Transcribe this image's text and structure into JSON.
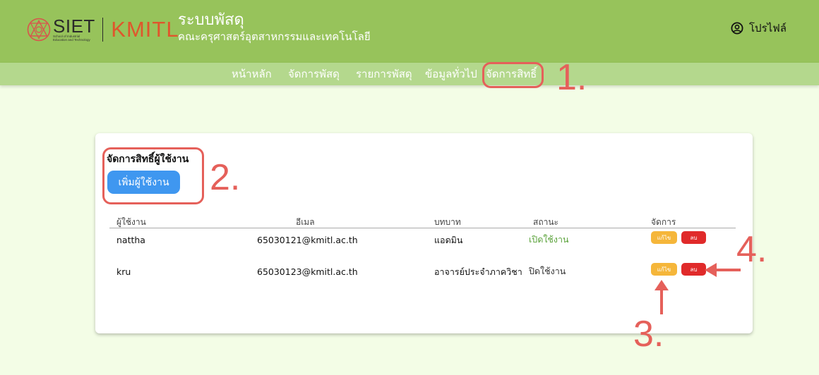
{
  "header": {
    "logo_siet": "SIET",
    "logo_siet_subtitle": [
      "School of Industrial",
      "Education and Technology"
    ],
    "logo_kmitl": "KMITL",
    "title": "ระบบพัสดุ",
    "subtitle": "คณะครุศาสตร์อุตสาหกรรมและเทคโนโลยี",
    "profile_label": "โปรไฟล์",
    "profile_icon": "user-circle-icon"
  },
  "nav": {
    "items": [
      {
        "label": "หน้าหลัก"
      },
      {
        "label": "จัดการพัสดุ"
      },
      {
        "label": "รายการพัสดุ"
      },
      {
        "label": "ข้อมูลทั่วไป"
      },
      {
        "label": "จัดการสิทธิ์",
        "active": true
      }
    ]
  },
  "card": {
    "title": "จัดการสิทธิ์ผู้ใช้งาน",
    "add_button_label": "เพิ่มผู้ใช้งาน"
  },
  "table": {
    "headers": [
      "ผู้ใช้งาน",
      "อีเมล",
      "บทบาท",
      "สถานะ",
      "จัดการ"
    ],
    "rows": [
      {
        "username": "nattha",
        "email": "65030121@kmitl.ac.th",
        "role": "แอดมิน",
        "status": "เปิดใช้งาน",
        "status_type": "active",
        "edit_label": "แก้ไข",
        "delete_label": "ลบ"
      },
      {
        "username": "kru",
        "email": "65030123@kmitl.ac.th",
        "role": "อาจารย์ประจำภาควิชา",
        "status": "ปิดใช้งาน",
        "status_type": "inactive",
        "edit_label": "แก้ไข",
        "delete_label": "ลบ"
      }
    ]
  },
  "annotations": {
    "markers": [
      "1.",
      "2.",
      "3.",
      "4."
    ],
    "color": "#e5605a"
  },
  "colors": {
    "header_bg": "#97c35b",
    "nav_bg": "#b4d88d",
    "page_bg": "#f3fde6",
    "primary_button": "#3f97f0",
    "edit_button": "#f5b63a",
    "delete_button": "#e02a2a",
    "status_active": "#5aa23a",
    "logo_kmitl": "#e0562c"
  }
}
